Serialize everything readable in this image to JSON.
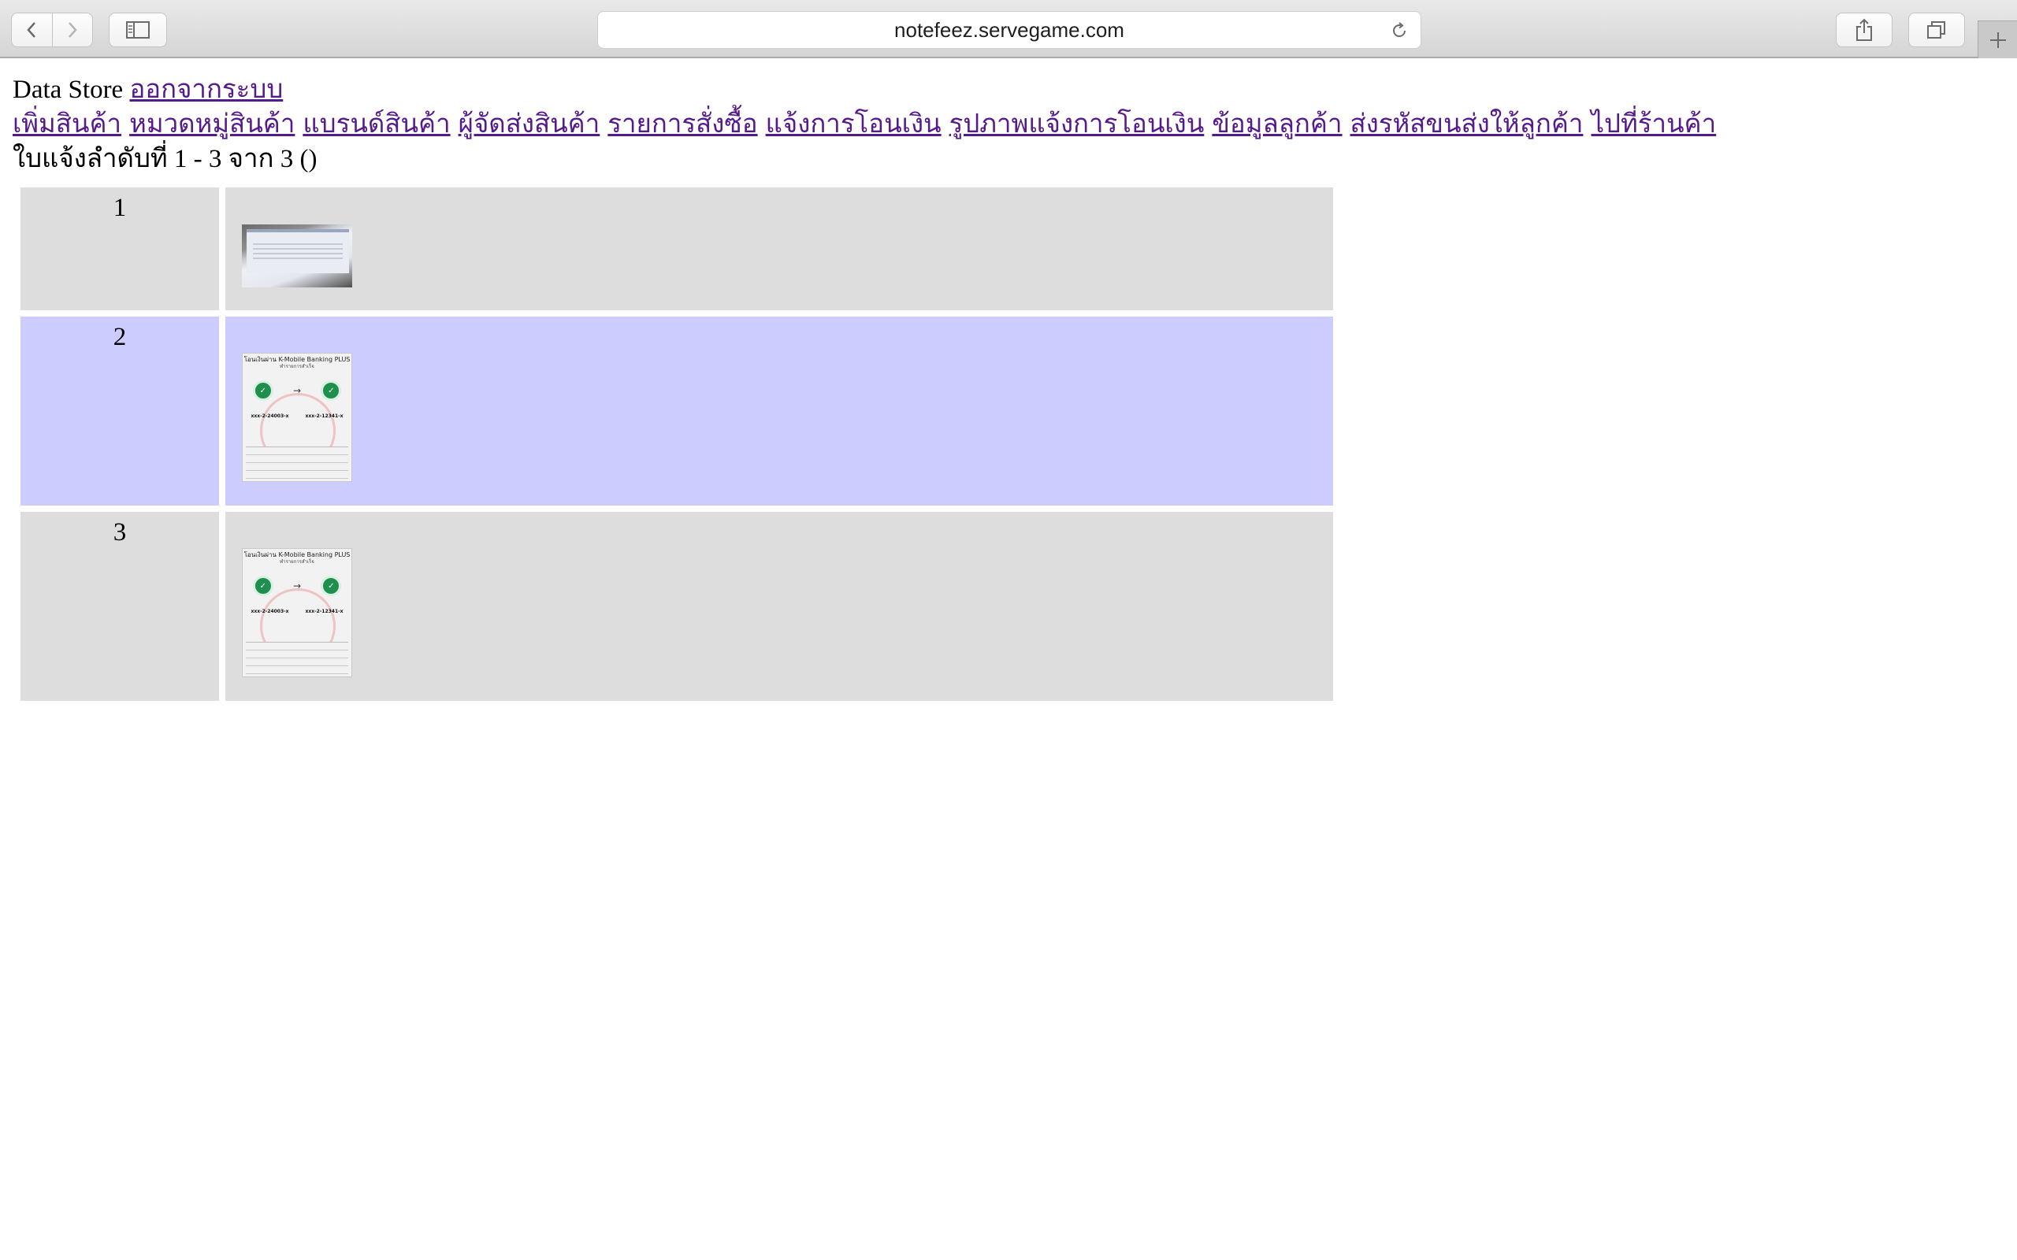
{
  "browser": {
    "url": "notefeez.servegame.com"
  },
  "header": {
    "title": "Data Store",
    "logout_label": "ออกจากระบบ"
  },
  "nav": {
    "links": [
      "เพิ่มสินค้า",
      "หมวดหมู่สินค้า",
      "แบรนด์สินค้า",
      "ผู้จัดส่งสินค้า",
      "รายการสั่งซื้อ",
      "แจ้งการโอนเงิน",
      "รูปภาพแจ้งการโอนเงิน",
      "ข้อมูลลูกค้า",
      "ส่งรหัสขนส่งให้ลูกค้า",
      "ไปที่ร้านค้า"
    ]
  },
  "summary": {
    "text": "ใบแจ้งลำดับที่ 1 - 3 จาก 3 ()"
  },
  "rows": [
    {
      "number": "1",
      "image": "transfer-photo"
    },
    {
      "number": "2",
      "image": "k-mobile-banking-slip"
    },
    {
      "number": "3",
      "image": "k-mobile-banking-slip"
    }
  ],
  "colors": {
    "row_gray": "#dddddd",
    "row_highlight": "#ccccff",
    "link": "#551a8b"
  }
}
